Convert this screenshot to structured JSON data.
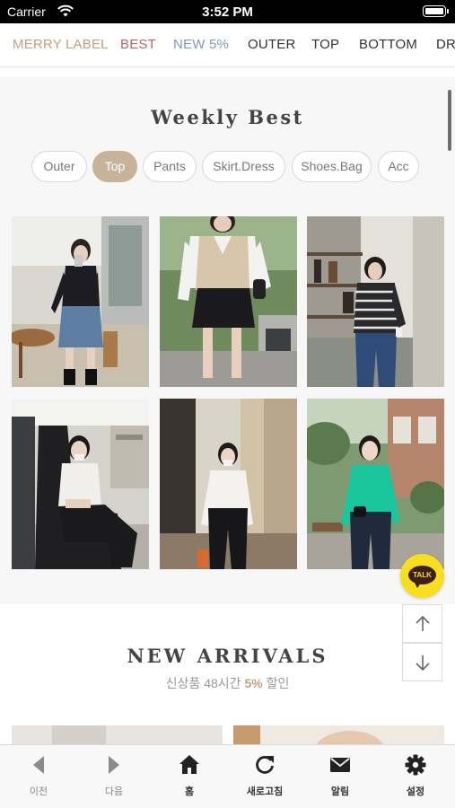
{
  "status_bar": {
    "carrier": "Carrier",
    "time": "3:52 PM"
  },
  "colors": {
    "accent_brand": "#c7b39a",
    "best_red": "#b5656a",
    "new_blue": "#7d9ab8",
    "talk_yellow": "#f9df1b"
  },
  "top_nav": [
    {
      "label": "MERRY LABEL",
      "color": "#c4a07a"
    },
    {
      "label": "BEST",
      "color": "#b5656a"
    },
    {
      "label": "NEW 5%",
      "color": "#7d9ab8"
    },
    {
      "label": "OUTER",
      "color": "#333333"
    },
    {
      "label": "TOP",
      "color": "#333333"
    },
    {
      "label": "BOTTOM",
      "color": "#333333"
    },
    {
      "label": "DR",
      "color": "#333333"
    }
  ],
  "weekly_best": {
    "title": "Weekly Best",
    "tabs": [
      "Outer",
      "Top",
      "Pants",
      "Skirt.Dress",
      "Shoes.Bag",
      "Acc"
    ],
    "active_tab": "Top",
    "products": [
      {
        "photo": "woman-black-cardigan-denim-skirt"
      },
      {
        "photo": "woman-beige-vest-black-skirt"
      },
      {
        "photo": "woman-striped-knit-jeans"
      },
      {
        "photo": "woman-white-tee-black-pants-seated"
      },
      {
        "photo": "woman-white-top-black-pants"
      },
      {
        "photo": "woman-green-knit-jeans"
      }
    ]
  },
  "floating": {
    "talk_label": "TALK",
    "up_icon": "arrow-up-icon",
    "down_icon": "arrow-down-icon"
  },
  "new_arrivals": {
    "title": "NEW ARRIVALS",
    "subtitle_before": "신상품 48시간",
    "subtitle_accent": "5%",
    "subtitle_after": "할인"
  },
  "toolbar": [
    {
      "label": "이전",
      "icon": "back-arrow-icon",
      "enabled": false
    },
    {
      "label": "다음",
      "icon": "forward-arrow-icon",
      "enabled": false
    },
    {
      "label": "홈",
      "icon": "home-icon",
      "enabled": true
    },
    {
      "label": "새로고침",
      "icon": "refresh-icon",
      "enabled": true
    },
    {
      "label": "알림",
      "icon": "mail-icon",
      "enabled": true
    },
    {
      "label": "설정",
      "icon": "gear-icon",
      "enabled": true
    }
  ]
}
